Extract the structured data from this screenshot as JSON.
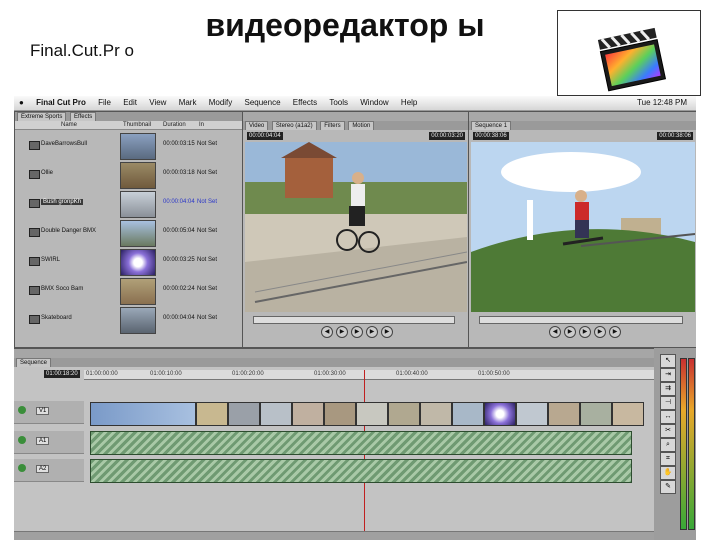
{
  "slide": {
    "title_left": "Final.Cut.Pr o",
    "title_main": "видеоредактор ы"
  },
  "app": {
    "menubar": {
      "apple": "",
      "app_name": "Final Cut Pro",
      "menus": [
        "File",
        "Edit",
        "View",
        "Mark",
        "Modify",
        "Sequence",
        "Effects",
        "Tools",
        "Window",
        "Help"
      ],
      "clock": "Tue 12:48 PM"
    },
    "browser": {
      "tabs": [
        "Extreme Sports",
        "Effects"
      ],
      "columns": [
        "Name",
        "Thumbnail",
        "Duration",
        "In"
      ],
      "rows": [
        {
          "name": "DaveBarrowsBull",
          "duration": "00:00:03:15",
          "in": "Not Set",
          "selected": false
        },
        {
          "name": "Ollie",
          "duration": "00:00:03:18",
          "in": "Not Set",
          "selected": false
        },
        {
          "name": "Bush gronpKh",
          "duration": "00:00:04:04",
          "in": "Not Set",
          "selected": true
        },
        {
          "name": "Double Danger BMX",
          "duration": "00:00:05:04",
          "in": "Not Set",
          "selected": false
        },
        {
          "name": "SWIRL",
          "duration": "00:00:03:25",
          "in": "Not Set",
          "selected": false
        },
        {
          "name": "BMX Soco Bam",
          "duration": "00:00:02:24",
          "in": "Not Set",
          "selected": false
        },
        {
          "name": "Skateboard",
          "duration": "00:00:04:04",
          "in": "Not Set",
          "selected": false
        }
      ]
    },
    "viewer": {
      "tabs": [
        "Video",
        "Stereo (a1a2)",
        "Filters",
        "Motion"
      ],
      "timecode_left": "00:00:04:04",
      "timecode_right": "00:00:03:20"
    },
    "canvas": {
      "tabs": [
        "Sequence 1"
      ],
      "timecode_left": "00:00:38:06",
      "timecode_right": "00:00:38:06"
    },
    "timeline": {
      "tab": "Sequence",
      "timecode": "01:00:18:20",
      "ruler": [
        "01:00:00:00",
        "01:00:10:00",
        "01:00:20:00",
        "01:00:30:00",
        "01:00:40:00",
        "01:00:50:00"
      ],
      "tracks": [
        "V1",
        "A1",
        "A2"
      ]
    },
    "colors": {
      "accent_selected_text": "#2a36c8",
      "audio_clip": "#8fb68f",
      "panel_bg": "#b8b8b8"
    }
  }
}
